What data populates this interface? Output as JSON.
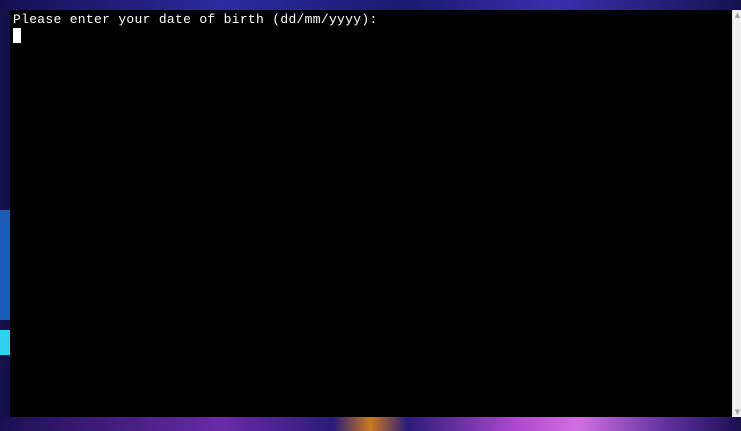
{
  "terminal": {
    "prompt": "Please enter your date of birth (dd/mm/yyyy):",
    "input_value": ""
  },
  "scrollbar": {
    "up_arrow_icon": "triangle-up",
    "down_arrow_icon": "triangle-down",
    "up_glyph": "▲",
    "down_glyph": "▼"
  },
  "colors": {
    "terminal_background": "#000000",
    "terminal_text": "#ffffff",
    "page_background": "#0b0a2a"
  }
}
